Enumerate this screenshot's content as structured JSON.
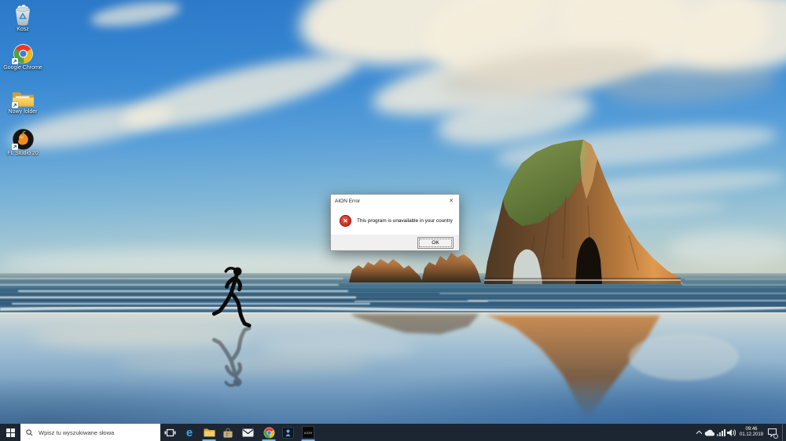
{
  "desktop_icons": [
    {
      "name": "recycle-bin",
      "label": "Kosz"
    },
    {
      "name": "google-chrome",
      "label": "Google Chrome"
    },
    {
      "name": "new-folder",
      "label": "Nowy folder"
    },
    {
      "name": "fl-studio",
      "label": "FL Studio 20"
    }
  ],
  "error_dialog": {
    "title": "AION Error",
    "close_glyph": "✕",
    "error_glyph": "✕",
    "message": "This program is unavailable in your country",
    "ok_label": "OK"
  },
  "taskbar": {
    "search_placeholder": "Wpisz tu wyszukiwane słowa",
    "edge_glyph": "e",
    "aion_glyph": "AION",
    "pinned_apps": [
      "task-view",
      "edge",
      "file-explorer",
      "microsoft-store",
      "mail",
      "chrome",
      "game-launcher",
      "aion"
    ],
    "running_apps": [
      "file-explorer",
      "chrome",
      "aion"
    ]
  },
  "system_tray": {
    "time": "09:46",
    "date": "01.12.2019"
  },
  "icons": {
    "start": "windows-logo",
    "search": "magnifier",
    "task_view": "stacked-windows",
    "tray": [
      "chevron-up",
      "onedrive-cloud",
      "network-signal",
      "volume-speaker",
      "action-center"
    ]
  },
  "colors": {
    "taskbar_bg": "#1c2632",
    "running_indicator": "#76b9e8",
    "error_red": "#c42b1c",
    "search_bg": "#ffffff"
  }
}
